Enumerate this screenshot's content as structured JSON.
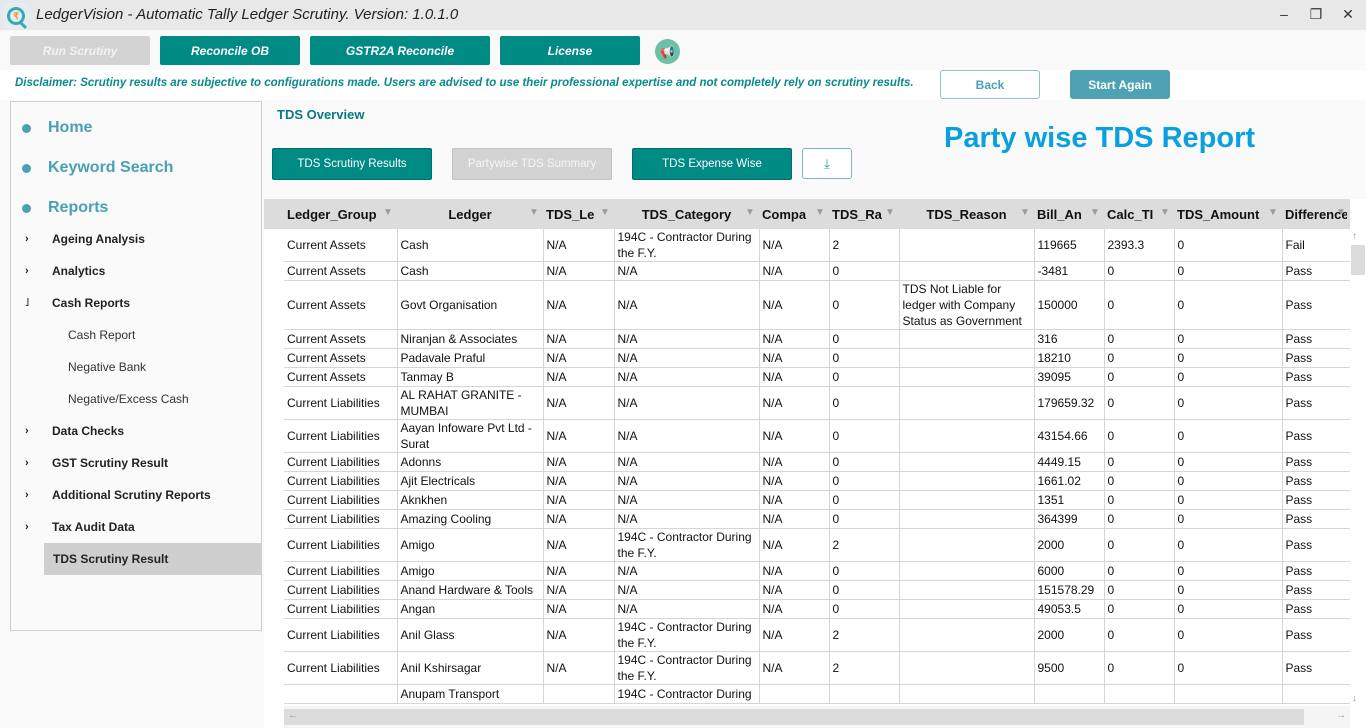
{
  "window": {
    "title": "LedgerVision - Automatic Tally Ledger Scrutiny.  Version: 1.0.1.0",
    "logo_icon": "rupee-magnifier-icon",
    "controls": {
      "minimize": "‒",
      "restore": "❐",
      "close": "✕"
    }
  },
  "toolbar": {
    "buttons": [
      {
        "label": "Run Scrutiny",
        "state": "disabled"
      },
      {
        "label": "Reconcile OB",
        "state": "enabled"
      },
      {
        "label": "GSTR2A Reconcile",
        "state": "enabled"
      },
      {
        "label": "License",
        "state": "enabled"
      }
    ],
    "announcement_icon": "megaphone-icon"
  },
  "disclaimer": {
    "text": "Disclaimer: Scrutiny results are subjective to configurations made. Users are advised to use their professional expertise and not completely rely on scrutiny results.",
    "back_label": "Back",
    "start_again_label": "Start Again"
  },
  "sidebar": {
    "main_items": [
      {
        "label": "Home"
      },
      {
        "label": "Keyword Search"
      },
      {
        "label": "Reports"
      }
    ],
    "report_items": [
      {
        "label": "Ageing Analysis",
        "expander": "›"
      },
      {
        "label": "Analytics",
        "expander": "›"
      },
      {
        "label": "Cash Reports",
        "expander": "˩"
      },
      {
        "label": "Data Checks",
        "expander": "›"
      },
      {
        "label": "GST Scrutiny Result",
        "expander": "›"
      },
      {
        "label": "Additional Scrutiny Reports",
        "expander": "›"
      },
      {
        "label": "Tax Audit Data",
        "expander": "›"
      }
    ],
    "cash_children": [
      {
        "label": "Cash Report"
      },
      {
        "label": "Negative Bank"
      },
      {
        "label": "Negative/Excess Cash"
      }
    ],
    "active_item": "TDS Scrutiny Result"
  },
  "main": {
    "section_title": "TDS Overview",
    "report_title": "Party wise TDS Report",
    "tabs": [
      {
        "label": "TDS Scrutiny Results",
        "state": "enabled"
      },
      {
        "label": "Partywise TDS Summary",
        "state": "selected-disabled"
      },
      {
        "label": "TDS Expense Wise",
        "state": "enabled"
      }
    ],
    "download_icon": "⤓"
  },
  "grid": {
    "columns": [
      "Ledger_Group",
      "Ledger",
      "TDS_Le",
      "TDS_Category",
      "Compa",
      "TDS_Ra",
      "TDS_Reason",
      "Bill_An",
      "Calc_TI",
      "TDS_Amount",
      "Difference"
    ],
    "rows": [
      [
        "Current Assets",
        "Cash",
        "N/A",
        "194C - Contractor During the F.Y.",
        "N/A",
        "2",
        "",
        "119665",
        "2393.3",
        "0",
        "Fail"
      ],
      [
        "Current Assets",
        "Cash",
        "N/A",
        "N/A",
        "N/A",
        "0",
        "",
        "-3481",
        "0",
        "0",
        "Pass"
      ],
      [
        "Current Assets",
        "Govt Organisation",
        "N/A",
        "N/A",
        "N/A",
        "0",
        "TDS Not Liable for ledger with Company Status as Government",
        "150000",
        "0",
        "0",
        "Pass"
      ],
      [
        "Current Assets",
        "Niranjan & Associates",
        "N/A",
        "N/A",
        "N/A",
        "0",
        "",
        "316",
        "0",
        "0",
        "Pass"
      ],
      [
        "Current Assets",
        "Padavale Praful",
        "N/A",
        "N/A",
        "N/A",
        "0",
        "",
        "18210",
        "0",
        "0",
        "Pass"
      ],
      [
        "Current Assets",
        "Tanmay B",
        "N/A",
        "N/A",
        "N/A",
        "0",
        "",
        "39095",
        "0",
        "0",
        "Pass"
      ],
      [
        "Current Liabilities",
        "AL RAHAT GRANITE - MUMBAI",
        "N/A",
        "N/A",
        "N/A",
        "0",
        "",
        "179659.32",
        "0",
        "0",
        "Pass"
      ],
      [
        "Current Liabilities",
        "Aayan Infoware Pvt Ltd - Surat",
        "N/A",
        "N/A",
        "N/A",
        "0",
        "",
        "43154.66",
        "0",
        "0",
        "Pass"
      ],
      [
        "Current Liabilities",
        "Adonns",
        "N/A",
        "N/A",
        "N/A",
        "0",
        "",
        "4449.15",
        "0",
        "0",
        "Pass"
      ],
      [
        "Current Liabilities",
        "Ajit Electricals",
        "N/A",
        "N/A",
        "N/A",
        "0",
        "",
        "1661.02",
        "0",
        "0",
        "Pass"
      ],
      [
        "Current Liabilities",
        "Aknkhen",
        "N/A",
        "N/A",
        "N/A",
        "0",
        "",
        "1351",
        "0",
        "0",
        "Pass"
      ],
      [
        "Current Liabilities",
        "Amazing Cooling",
        "N/A",
        "N/A",
        "N/A",
        "0",
        "",
        "364399",
        "0",
        "0",
        "Pass"
      ],
      [
        "Current Liabilities",
        "Amigo",
        "N/A",
        "194C - Contractor During the F.Y.",
        "N/A",
        "2",
        "",
        "2000",
        "0",
        "0",
        "Pass"
      ],
      [
        "Current Liabilities",
        "Amigo",
        "N/A",
        "N/A",
        "N/A",
        "0",
        "",
        "6000",
        "0",
        "0",
        "Pass"
      ],
      [
        "Current Liabilities",
        "Anand Hardware & Tools",
        "N/A",
        "N/A",
        "N/A",
        "0",
        "",
        "151578.29",
        "0",
        "0",
        "Pass"
      ],
      [
        "Current Liabilities",
        "Angan",
        "N/A",
        "N/A",
        "N/A",
        "0",
        "",
        "49053.5",
        "0",
        "0",
        "Pass"
      ],
      [
        "Current Liabilities",
        "Anil Glass",
        "N/A",
        "194C - Contractor During the F.Y.",
        "N/A",
        "2",
        "",
        "2000",
        "0",
        "0",
        "Pass"
      ],
      [
        "Current Liabilities",
        "Anil Kshirsagar",
        "N/A",
        "194C - Contractor During the F.Y.",
        "N/A",
        "2",
        "",
        "9500",
        "0",
        "0",
        "Pass"
      ],
      [
        "",
        "Anupam Transport",
        "",
        "194C - Contractor During",
        "",
        "",
        "",
        "",
        "",
        "",
        ""
      ]
    ],
    "scroll_icons": {
      "up": "↑",
      "down": "↓",
      "left": "←",
      "right": "→"
    }
  }
}
